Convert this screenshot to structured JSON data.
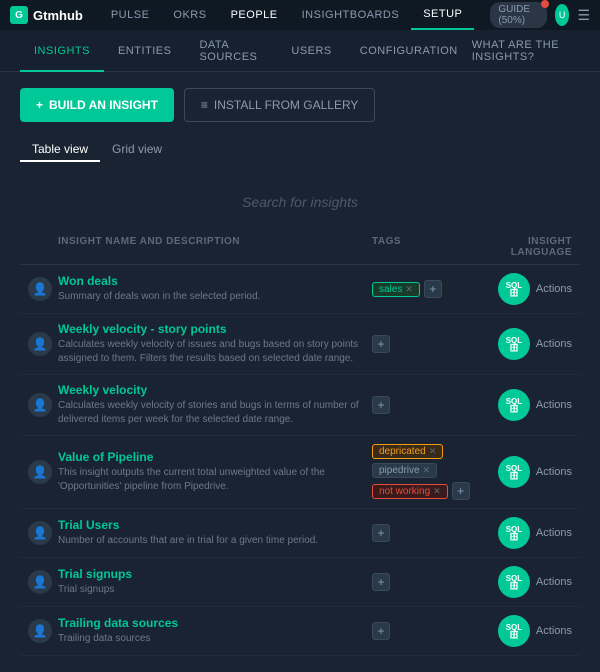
{
  "topNav": {
    "logo": "Gtmhub",
    "items": [
      "PULSE",
      "OKRs",
      "PEOPLE",
      "INSIGHTBOARDS",
      "SETUP",
      "GUIDE (50%)"
    ],
    "activeItem": "SETUP",
    "guideLabel": "GUIDE (50%)"
  },
  "subNav": {
    "items": [
      "INSIGHTS",
      "ENTITIES",
      "DATA SOURCES",
      "USERS",
      "CONFIGURATION"
    ],
    "activeItem": "INSIGHTS",
    "rightLink": "WHAT ARE THE INSIGHTS?"
  },
  "actions": {
    "buildLabel": "BUILD AN INSIGHT",
    "installLabel": "INSTALL FROM GALLERY"
  },
  "viewTabs": {
    "tabs": [
      "Table view",
      "Grid view"
    ],
    "activeTab": "Table view"
  },
  "search": {
    "placeholder": "Search for insights"
  },
  "tableHeaders": {
    "nameCol": "INSIGHT NAME AND DESCRIPTION",
    "tagsCol": "TAGS",
    "langCol": "INSIGHT LANGUAGE"
  },
  "rows": [
    {
      "id": 1,
      "title": "Won deals",
      "description": "Summary of deals won in the selected period.",
      "tags": [
        {
          "label": "sales",
          "type": "green"
        }
      ],
      "hasPlus": true,
      "sqlLabel": "SQL",
      "actionsLabel": "Actions"
    },
    {
      "id": 2,
      "title": "Weekly velocity - story points",
      "description": "Calculates weekly velocity of issues and bugs based on story points assigned to them. Filters the results based on selected date range.",
      "tags": [],
      "hasPlus": true,
      "sqlLabel": "SQL",
      "actionsLabel": "Actions"
    },
    {
      "id": 3,
      "title": "Weekly velocity",
      "description": "Calculates weekly velocity of stories and bugs in terms of number of delivered items per week for the selected date range.",
      "tags": [],
      "hasPlus": true,
      "sqlLabel": "SQL",
      "actionsLabel": "Actions"
    },
    {
      "id": 4,
      "title": "Value of Pipeline",
      "description": "This insight outputs the current total unweighted value of the 'Opportunities' pipeline from Pipedrive.",
      "tags": [
        {
          "label": "depricated",
          "type": "orange"
        },
        {
          "label": "pipedrive",
          "type": "default"
        },
        {
          "label": "not working",
          "type": "red"
        }
      ],
      "hasPlus": true,
      "sqlLabel": "SQL",
      "actionsLabel": "Actions"
    },
    {
      "id": 5,
      "title": "Trial Users",
      "description": "Number of accounts that are in trial for a given time period.",
      "tags": [],
      "hasPlus": true,
      "sqlLabel": "SQL",
      "actionsLabel": "Actions"
    },
    {
      "id": 6,
      "title": "Trial signups",
      "description": "Trial signups",
      "tags": [],
      "hasPlus": true,
      "sqlLabel": "SQL",
      "actionsLabel": "Actions"
    },
    {
      "id": 7,
      "title": "Trailing data sources",
      "description": "Trailing data sources",
      "tags": [],
      "hasPlus": true,
      "sqlLabel": "SQL",
      "actionsLabel": "Actions"
    }
  ]
}
